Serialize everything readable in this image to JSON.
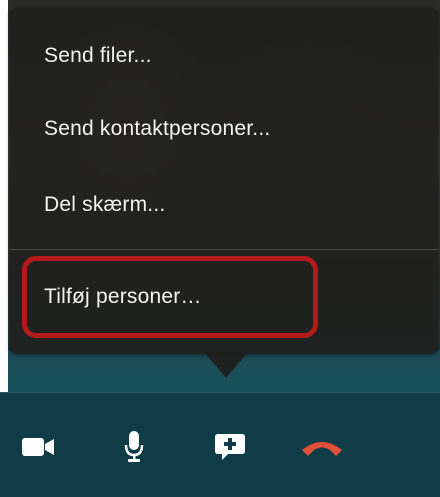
{
  "menu": {
    "items": [
      {
        "label": "Send filer..."
      },
      {
        "label": "Send kontaktpersoner..."
      },
      {
        "label": "Del skærm..."
      },
      {
        "label": "Tilføj personer…"
      }
    ],
    "highlighted_item": "Tilføj personer…",
    "highlight_color": "#b41a1a"
  },
  "toolbar": {
    "buttons": [
      {
        "icon": "video-camera-icon",
        "color": "#ffffff"
      },
      {
        "icon": "microphone-icon",
        "color": "#ffffff"
      },
      {
        "icon": "chat-add-icon",
        "color": "#ffffff"
      },
      {
        "icon": "hang-up-icon",
        "color": "#e0503a"
      }
    ]
  }
}
